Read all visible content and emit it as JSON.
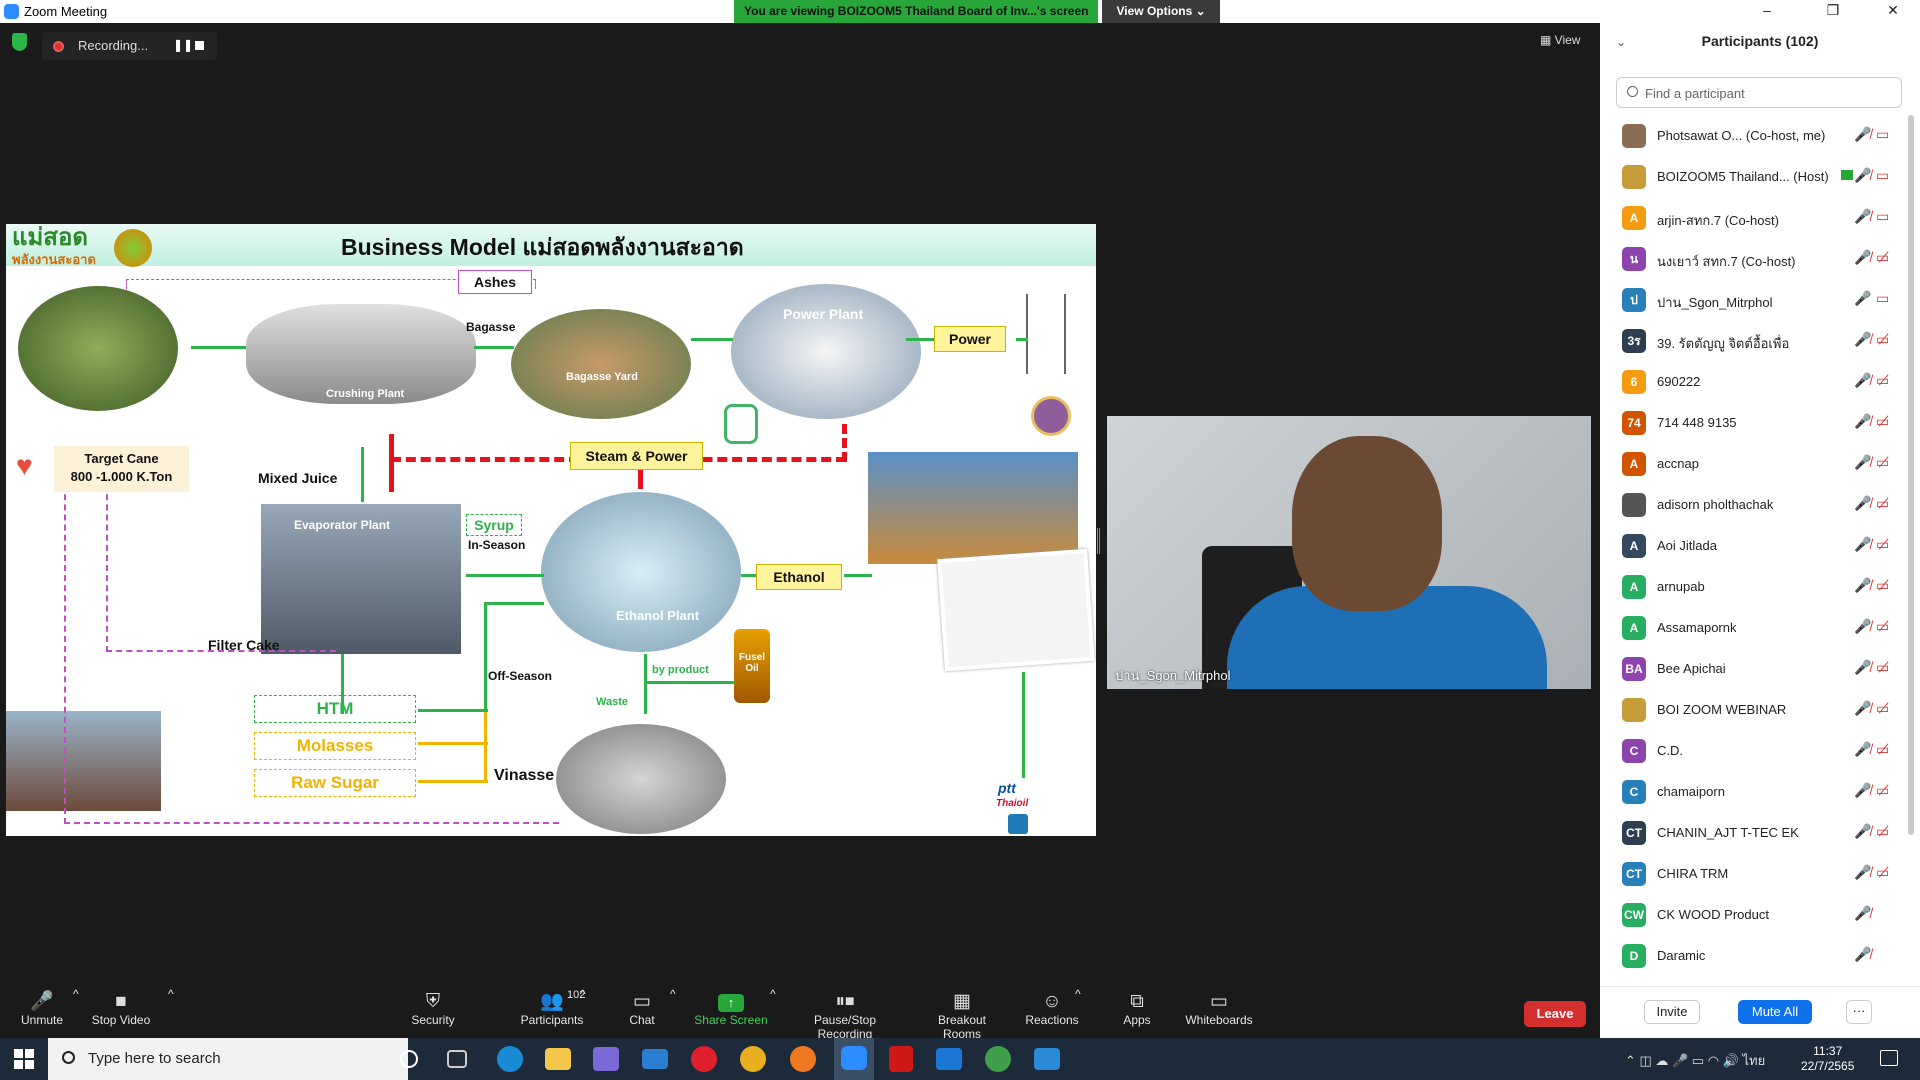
{
  "window": {
    "title": "Zoom Meeting",
    "minimize": "–",
    "restore": "❐",
    "close": "✕"
  },
  "share_banner": {
    "viewing": "You are viewing BOIZOOM5 Thailand Board of Inv...'s screen",
    "view_options": "View Options ⌄"
  },
  "recording": {
    "label": "Recording...",
    "pause": "❚❚"
  },
  "view_button": "▦ View",
  "slide": {
    "logo_main": "แม่สอด",
    "logo_sub": "พลังงานสะอาด",
    "title": "Business Model  แม่สอดพลังงานสะอาด",
    "ashes": "Ashes",
    "bagasse": "Bagasse",
    "crushing_plant": "Crushing Plant",
    "bagasse_yard": "Bagasse Yard",
    "power_plant": "Power Plant",
    "power": "Power",
    "steam_power": "Steam & Power",
    "target_cane": "Target Cane",
    "target_value": "800 -1.000 K.Ton",
    "mixed_juice": "Mixed Juice",
    "evaporator_plant": "Evaporator Plant",
    "syrup": "Syrup",
    "in_season": "In-Season",
    "ethanol_plant": "Ethanol Plant",
    "ethanol": "Ethanol",
    "filter_cake": "Filter Cake",
    "htm": "HTM",
    "molasses": "Molasses",
    "raw_sugar": "Raw Sugar",
    "off_season": "Off-Season",
    "by_product": "by product",
    "fusel_oil": "Fusel Oil",
    "waste": "Waste",
    "vinasse": "Vinasse",
    "ptt": "ptt",
    "thaioil": "Thaioil"
  },
  "video": {
    "name": "ปาน_Sgon_Mitrphol"
  },
  "participants": {
    "header": "Participants (102)",
    "search_placeholder": "Find a participant",
    "items": [
      {
        "initials": "",
        "name": "Photsawat O... (Co-host, me)",
        "color": "#8a6d55",
        "mic": "🎤̸",
        "cam": "▭"
      },
      {
        "initials": "",
        "name": "BOIZOOM5 Thailand... (Host)",
        "color": "#c69c3a",
        "mic": "🎤̸",
        "cam": "▭"
      },
      {
        "initials": "A",
        "name": "arjin-สทก.7 (Co-host)",
        "color": "#f39c12",
        "mic": "🎤̸",
        "cam": "▭"
      },
      {
        "initials": "น",
        "name": "นงเยาว์ สทก.7 (Co-host)",
        "color": "#8e44ad",
        "mic": "🎤̸",
        "cam": "▭̸"
      },
      {
        "initials": "ป",
        "name": "ปาน_Sgon_Mitrphol",
        "color": "#2980b9",
        "mic": "🎤",
        "cam": "▭"
      },
      {
        "initials": "3ร",
        "name": "39. รัตตัญญู จิตต์อื้อเพื่อ",
        "color": "#2c3e50",
        "mic": "🎤̸",
        "cam": "▭̸"
      },
      {
        "initials": "6",
        "name": "690222",
        "color": "#f39c12",
        "mic": "🎤̸",
        "cam": "▭̸"
      },
      {
        "initials": "74",
        "name": "714 448 9135",
        "color": "#d35400",
        "mic": "🎤̸",
        "cam": "▭̸"
      },
      {
        "initials": "A",
        "name": "accnap",
        "color": "#d35400",
        "mic": "🎤̸",
        "cam": "▭̸"
      },
      {
        "initials": "",
        "name": "adisorn pholthachak",
        "color": "#555555",
        "mic": "🎤̸",
        "cam": "▭̸"
      },
      {
        "initials": "A",
        "name": "Aoi Jitlada",
        "color": "#34495e",
        "mic": "🎤̸",
        "cam": "▭̸"
      },
      {
        "initials": "A",
        "name": "arnupab",
        "color": "#27ae60",
        "mic": "🎤̸",
        "cam": "▭̸"
      },
      {
        "initials": "A",
        "name": "Assamapornk",
        "color": "#27ae60",
        "mic": "🎤̸",
        "cam": "▭̸"
      },
      {
        "initials": "BA",
        "name": "Bee Apichai",
        "color": "#8e44ad",
        "mic": "🎤̸",
        "cam": "▭̸"
      },
      {
        "initials": "",
        "name": "BOI ZOOM WEBINAR",
        "color": "#c69c3a",
        "mic": "🎤̸",
        "cam": "▭̸"
      },
      {
        "initials": "C",
        "name": "C.D.",
        "color": "#8e44ad",
        "mic": "🎤̸",
        "cam": "▭̸"
      },
      {
        "initials": "C",
        "name": "chamaiporn",
        "color": "#2980b9",
        "mic": "🎤̸",
        "cam": "▭̸"
      },
      {
        "initials": "CT",
        "name": "CHANIN_AJT T-TEC EK",
        "color": "#2c3e50",
        "mic": "🎤̸",
        "cam": "▭̸"
      },
      {
        "initials": "CT",
        "name": "CHIRA TRM",
        "color": "#2980b9",
        "mic": "🎤̸",
        "cam": "▭̸"
      },
      {
        "initials": "CW",
        "name": "CK WOOD Product",
        "color": "#27ae60",
        "mic": "🎤̸",
        "cam": ""
      },
      {
        "initials": "D",
        "name": "Daramic",
        "color": "#27ae60",
        "mic": "🎤̸",
        "cam": ""
      }
    ],
    "invite": "Invite",
    "mute_all": "Mute All",
    "more": "···"
  },
  "toolbar": {
    "unmute": "Unmute",
    "stop_video": "Stop Video",
    "security": "Security",
    "participants": "Participants",
    "participants_count": "102",
    "chat": "Chat",
    "share_screen": "Share Screen",
    "pause_recording": "Pause/Stop Recording",
    "breakout_rooms": "Breakout Rooms",
    "reactions": "Reactions",
    "apps": "Apps",
    "whiteboards": "Whiteboards",
    "leave": "Leave",
    "caret": "^"
  },
  "taskbar": {
    "search_placeholder": "Type here to search",
    "lang": "ไทย",
    "time": "11:37",
    "date": "22/7/2565"
  }
}
